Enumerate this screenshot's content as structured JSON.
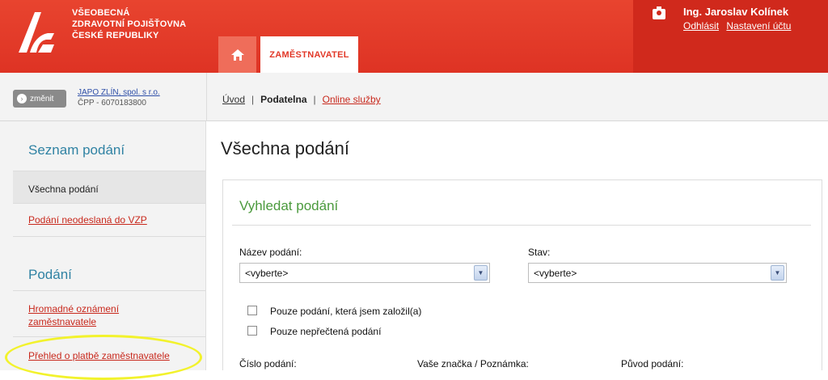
{
  "header": {
    "brand_line1": "VŠEOBECNÁ",
    "brand_line2": "ZDRAVOTNÍ POJIŠŤOVNA",
    "brand_line3": "ČESKÉ REPUBLIKY",
    "tab_active": "ZAMĚSTNAVATEL",
    "user_name": "Ing. Jaroslav Kolínek",
    "logout_label": "Odhlásit",
    "account_settings_label": "Nastavení účtu"
  },
  "subbar": {
    "change_label": "změnit",
    "company_name": "JAPO ZLÍN, spol. s r.o.",
    "company_id": "ČPP - 6070183800",
    "nav": {
      "uvod": "Úvod",
      "podatelna": "Podatelna",
      "online": "Online služby"
    }
  },
  "sidebar": {
    "section1_title": "Seznam podání",
    "item_all": "Všechna podání",
    "item_unsent": "Podání neodeslaná do VZP",
    "section2_title": "Podání",
    "item_bulk_line1": "Hromadné oznámení",
    "item_bulk_line2": "zaměstnavatele",
    "item_overview": "Přehled o platbě zaměstnavatele"
  },
  "main": {
    "title": "Všechna podání",
    "search_title": "Vyhledat podání",
    "label_name": "Název podání:",
    "label_state": "Stav:",
    "select_name_value": "<vyberte>",
    "select_state_value": "<vyberte>",
    "check_mine": "Pouze podání, která jsem založil(a)",
    "check_unread": "Pouze nepřečtená podání",
    "label_number": "Číslo podání:",
    "label_ref": "Vaše značka / Poznámka:",
    "label_origin": "Původ podání:"
  },
  "colors": {
    "brand_red": "#e23828",
    "heading_blue": "#2f82a3",
    "panel_green": "#4b9a3d",
    "highlight_yellow": "#f2f22c"
  },
  "icons": [
    "vzp-logo-icon",
    "home-icon",
    "user-icon",
    "arrow-circle-icon",
    "dropdown-arrow-icon"
  ]
}
